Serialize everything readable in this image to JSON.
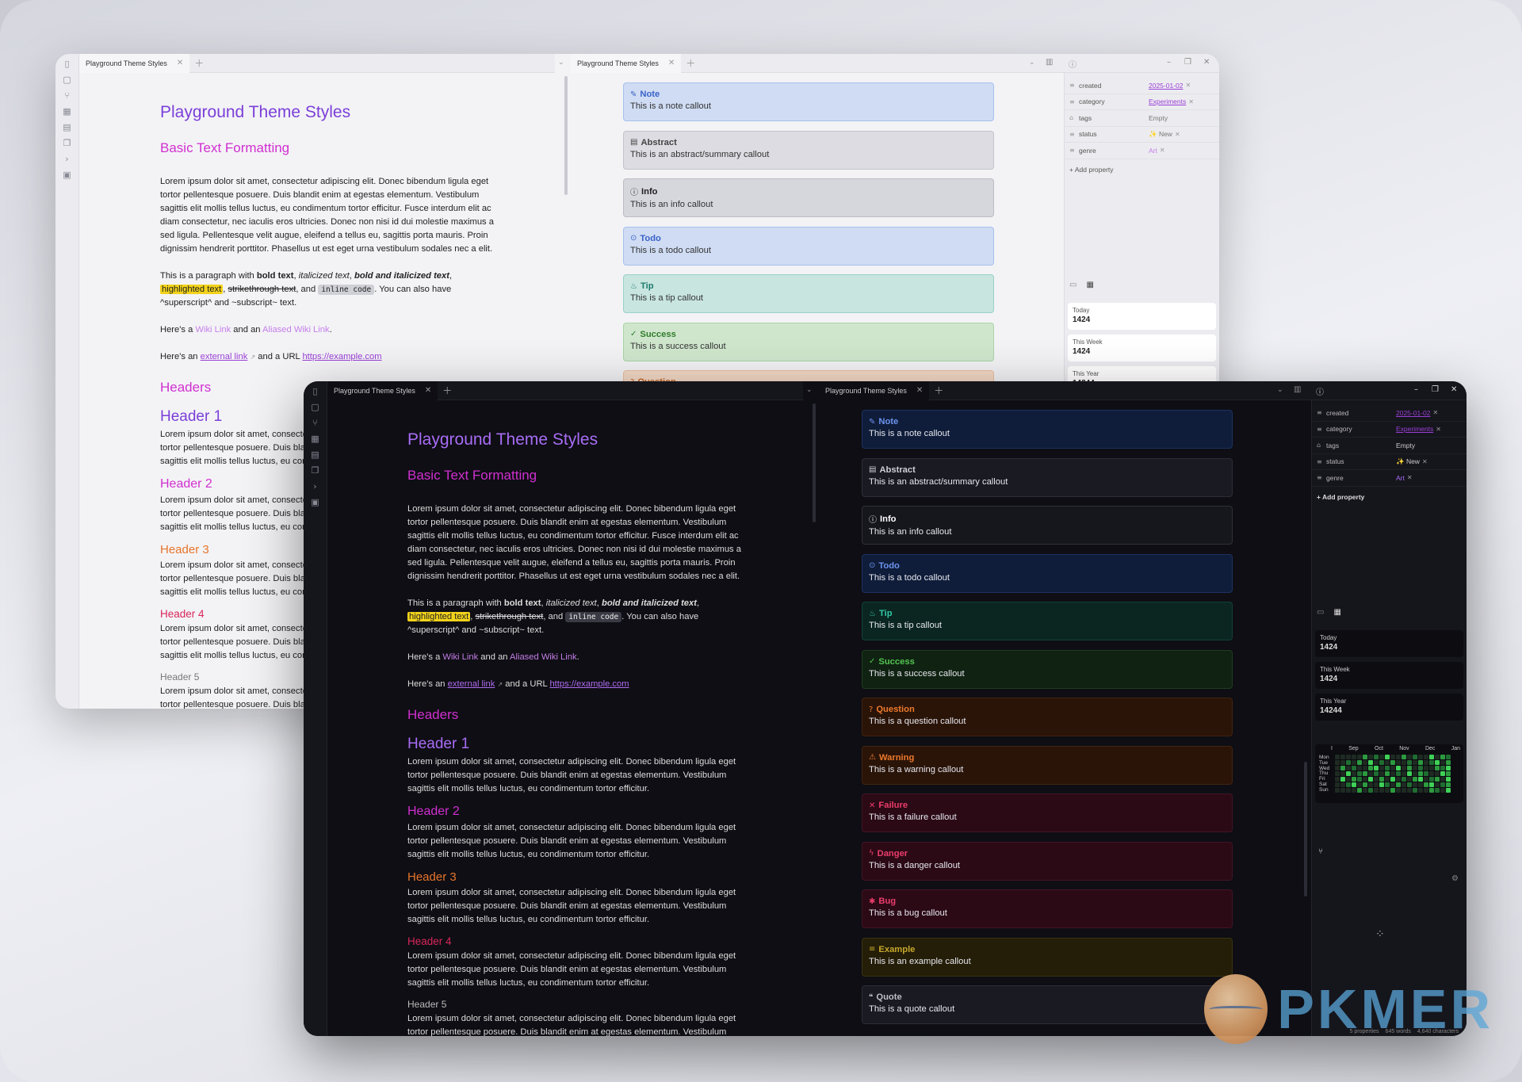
{
  "tab_title": "Playground Theme Styles",
  "note": {
    "title": "Playground Theme Styles",
    "h_basic": "Basic Text Formatting",
    "lorem_long": "Lorem ipsum dolor sit amet, consectetur adipiscing elit. Donec bibendum ligula eget tortor pellentesque posuere. Duis blandit enim at egestas elementum. Vestibulum sagittis elit mollis tellus luctus, eu condimentum tortor efficitur. Fusce interdum elit ac diam consectetur, nec iaculis eros ultricies. Donec non nisi id dui molestie maximus a sed ligula. Pellentesque velit augue, eleifend a tellus eu, sagittis porta mauris. Proin dignissim hendrerit porttitor. Phasellus ut est eget urna vestibulum sodales nec a elit.",
    "para_pre": "This is a paragraph with ",
    "bold": "bold text",
    "comma1": ", ",
    "italic": "italicized text",
    "comma2": ", ",
    "bold_italic": "bold and italicized text",
    "comma3": ",",
    "highlight": "highlighted text",
    "comma4": ", ",
    "strike": "strikethrough text",
    "and": ", and ",
    "code": "inline code",
    "para_post": ". You can also have ^superscript^ and ~subscript~ text.",
    "wiki_pre": "Here's a ",
    "wiki": "Wiki Link",
    "wiki_mid": " and an ",
    "wiki_alias": "Aliased Wiki Link",
    "wiki_post": ".",
    "ext_pre": "Here's an ",
    "ext_link": "external link",
    "ext_mid": " and a URL ",
    "url": "https://example.com",
    "h_headers": "Headers",
    "header1": "Header 1",
    "header2": "Header 2",
    "header3": "Header 3",
    "header4": "Header 4",
    "header5": "Header 5",
    "lorem_short": "Lorem ipsum dolor sit amet, consectetur adipiscing elit. Donec bibendum ligula eget tortor pellentesque posuere. Duis blandit enim at egestas elementum. Vestibulum sagittis elit mollis tellus luctus, eu condimentum tortor efficitur."
  },
  "callouts": [
    {
      "title": "Note",
      "body": "This is a note callout",
      "icon": "pencil-icon",
      "glyph": "✎",
      "light": [
        "#cfdcf3",
        "#a8c0ec",
        "#3a62c9"
      ],
      "dark": [
        "#0f1d3a",
        "#1d3160",
        "#6d93ee"
      ]
    },
    {
      "title": "Abstract",
      "body": "This is an abstract/summary callout",
      "icon": "clipboard-icon",
      "glyph": "▤",
      "light": [
        "#dcdce2",
        "#c3c3cc",
        "#444"
      ],
      "dark": [
        "#1a1a22",
        "#2d2d38",
        "#cfcfd8"
      ]
    },
    {
      "title": "Info",
      "body": "This is an info callout",
      "icon": "info-icon",
      "glyph": "ⓘ",
      "light": [
        "#d6d6dd",
        "#bdbdc6",
        "#222"
      ],
      "dark": [
        "#16161d",
        "#30303a",
        "#ffffff"
      ]
    },
    {
      "title": "Todo",
      "body": "This is a todo callout",
      "icon": "check-circle-icon",
      "glyph": "⊙",
      "light": [
        "#cfdcf3",
        "#a8c0ec",
        "#3a62c9"
      ],
      "dark": [
        "#0f1d3a",
        "#1d3160",
        "#6d93ee"
      ]
    },
    {
      "title": "Tip",
      "body": "This is a tip callout",
      "icon": "flame-icon",
      "glyph": "♨",
      "light": [
        "#c8e5e0",
        "#99d1c7",
        "#1c7c6c"
      ],
      "dark": [
        "#0b2621",
        "#12403a",
        "#2fc7a6"
      ]
    },
    {
      "title": "Success",
      "body": "This is a success callout",
      "icon": "check-icon",
      "glyph": "✓",
      "light": [
        "#cfe6cd",
        "#a9d5a4",
        "#2f7c2a"
      ],
      "dark": [
        "#102312",
        "#1f3d20",
        "#53c452"
      ]
    },
    {
      "title": "Question",
      "body": "This is a question callout",
      "icon": "help-circle-icon",
      "glyph": "?",
      "light": [
        "#f4d9c6",
        "#ecbfa0",
        "#c4611e"
      ],
      "dark": [
        "#2a1408",
        "#43230f",
        "#ee7a2c"
      ]
    },
    {
      "title": "Warning",
      "body": "This is a warning callout",
      "icon": "alert-triangle-icon",
      "glyph": "⚠",
      "light": [
        "#f4d9c6",
        "#ecbfa0",
        "#c4611e"
      ],
      "dark": [
        "#2a1408",
        "#43230f",
        "#ee7a2c"
      ]
    },
    {
      "title": "Failure",
      "body": "This is a failure callout",
      "icon": "x-icon",
      "glyph": "✕",
      "light": [
        "#f4d0db",
        "#e8a8bb",
        "#c41e4b"
      ],
      "dark": [
        "#2b0a15",
        "#441425",
        "#ec3c6c"
      ]
    },
    {
      "title": "Danger",
      "body": "This is a danger callout",
      "icon": "zap-icon",
      "glyph": "ϟ",
      "light": [
        "#f4d0db",
        "#e8a8bb",
        "#c41e4b"
      ],
      "dark": [
        "#2b0a15",
        "#441425",
        "#ec3c6c"
      ]
    },
    {
      "title": "Bug",
      "body": "This is a bug callout",
      "icon": "bug-icon",
      "glyph": "✱",
      "light": [
        "#f4d0db",
        "#e8a8bb",
        "#c41e4b"
      ],
      "dark": [
        "#2b0a15",
        "#441425",
        "#ec3c6c"
      ]
    },
    {
      "title": "Example",
      "body": "This is an example callout",
      "icon": "list-icon",
      "glyph": "≡",
      "light": [
        "#efe6c4",
        "#ddd09a",
        "#9a8420"
      ],
      "dark": [
        "#241e08",
        "#3a3210",
        "#c6a72c"
      ]
    },
    {
      "title": "Quote",
      "body": "This is a quote callout",
      "icon": "quote-icon",
      "glyph": "❝",
      "light": [
        "#dcdce2",
        "#c3c3cc",
        "#444"
      ],
      "dark": [
        "#1a1a22",
        "#2d2d38",
        "#bdbdc6"
      ]
    }
  ],
  "properties": [
    {
      "key": "created",
      "value": "2025-01-02",
      "icon": "list-icon",
      "link": true,
      "removable": true
    },
    {
      "key": "category",
      "value": "Experiments",
      "icon": "list-icon",
      "link": true,
      "removable": true
    },
    {
      "key": "tags",
      "value": "Empty",
      "icon": "tag-icon",
      "link": false,
      "removable": false
    },
    {
      "key": "status",
      "value": "✨ New",
      "icon": "list-icon",
      "link": false,
      "removable": true
    },
    {
      "key": "genre",
      "value": "Art",
      "icon": "list-icon",
      "link": false,
      "removable": true
    }
  ],
  "add_property": "+ Add property",
  "stats": [
    {
      "label": "Today",
      "value": "1424"
    },
    {
      "label": "This Week",
      "value": "1424"
    },
    {
      "label": "This Year",
      "value": "14244"
    }
  ],
  "heatmap": {
    "months": [
      "I",
      "Sep",
      "Oct",
      "Nov",
      "Dec",
      "Jan"
    ],
    "days": [
      "Mon",
      "Tue",
      "Wed",
      "Thu",
      "Fri",
      "Sat",
      "Sun"
    ],
    "levels": [
      0,
      0,
      0,
      0,
      0,
      2,
      0,
      1,
      0,
      3,
      0,
      0,
      2,
      0,
      1,
      0,
      0,
      3,
      0,
      2,
      1,
      0,
      0,
      1,
      0,
      2,
      0,
      3,
      0,
      1,
      0,
      2,
      0,
      0,
      1,
      0,
      2,
      0,
      1,
      3,
      0,
      2,
      0,
      2,
      0,
      1,
      0,
      0,
      2,
      3,
      0,
      1,
      0,
      3,
      0,
      2,
      0,
      1,
      0,
      0,
      2,
      1,
      3,
      0,
      0,
      3,
      0,
      1,
      2,
      0,
      1,
      0,
      2,
      0,
      1,
      0,
      3,
      0,
      2,
      1,
      0,
      0,
      3,
      2,
      0,
      3,
      0,
      2,
      1,
      0,
      3,
      0,
      2,
      0,
      3,
      0,
      1,
      0,
      2,
      3,
      0,
      1,
      2,
      0,
      3,
      0,
      0,
      1,
      3,
      0,
      2,
      0,
      0,
      3,
      1,
      0,
      2,
      0,
      1,
      0,
      0,
      2,
      3,
      0,
      1,
      2,
      0,
      0,
      0,
      0,
      2,
      0,
      1,
      0,
      0,
      0,
      2,
      0,
      0,
      0,
      1,
      0,
      0,
      2,
      1,
      0,
      3
    ],
    "colors": [
      "#1e2a22",
      "#1f6d31",
      "#2c9b3f",
      "#3fd157"
    ]
  },
  "status_bar": {
    "properties": "5 properties",
    "words": "645 words",
    "chars": "4,640 characters"
  },
  "watermark": "PKMER"
}
